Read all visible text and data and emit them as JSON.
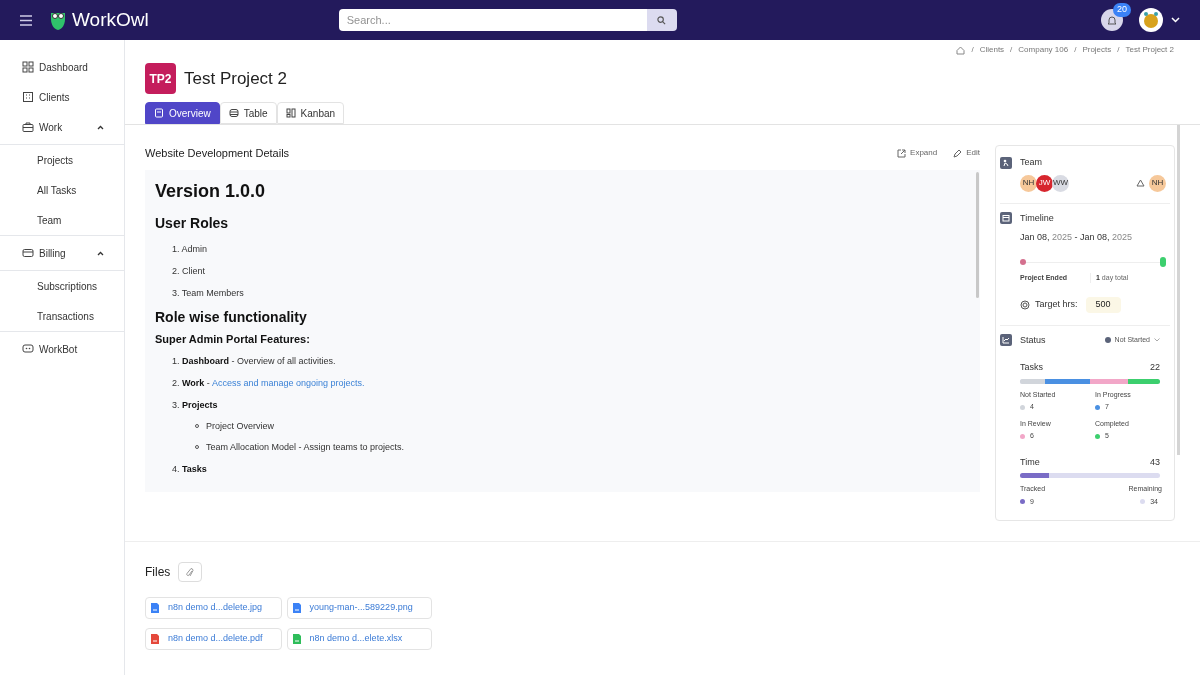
{
  "app": {
    "name": "WorkOwl"
  },
  "search": {
    "placeholder": "Search..."
  },
  "notifications": {
    "count": "20"
  },
  "sidebar": {
    "items": [
      {
        "label": "Dashboard",
        "kind": "grid"
      },
      {
        "label": "Clients",
        "kind": "building"
      },
      {
        "label": "Work",
        "kind": "briefcase",
        "expanded": true,
        "children": [
          {
            "label": "Projects"
          },
          {
            "label": "All Tasks"
          },
          {
            "label": "Team"
          }
        ]
      },
      {
        "label": "Billing",
        "kind": "card",
        "expanded": true,
        "children": [
          {
            "label": "Subscriptions"
          },
          {
            "label": "Transactions"
          }
        ]
      },
      {
        "label": "WorkBot",
        "kind": "bot"
      }
    ]
  },
  "breadcrumb": {
    "separator": "/",
    "items": [
      "Clients",
      "Company 106",
      "Projects",
      "Test Project 2"
    ]
  },
  "project": {
    "badge": "TP2",
    "title": "Test Project 2"
  },
  "tabs": [
    {
      "label": "Overview",
      "kind": "doc",
      "selected": true
    },
    {
      "label": "Table",
      "kind": "table",
      "selected": false
    },
    {
      "label": "Kanban",
      "kind": "kanban",
      "selected": false
    }
  ],
  "details": {
    "title": "Website Development Details",
    "actions": [
      {
        "label": "Expand",
        "kind": "expand"
      },
      {
        "label": "Edit",
        "kind": "pencil"
      }
    ],
    "blocks": [
      {
        "kind": "h1",
        "text": "Version 1.0.0"
      },
      {
        "kind": "h2",
        "text": "User Roles"
      },
      {
        "kind": "ol",
        "items": [
          {
            "number": "1.",
            "text": "Admin"
          },
          {
            "number": "2.",
            "text": "Client"
          },
          {
            "number": "3.",
            "text": "Team Members"
          }
        ]
      },
      {
        "kind": "h2",
        "text": "Role wise functionality"
      },
      {
        "kind": "h3",
        "text": "Super Admin Portal Features:"
      },
      {
        "kind": "ol",
        "items": [
          {
            "number": "1.",
            "lead": "Dashboard",
            "dash": "-",
            "text": "Overview of all activities."
          },
          {
            "number": "2.",
            "lead": "Work",
            "dash": "-",
            "text": "Access and manage ongoing projects.",
            "link": true
          },
          {
            "number": "3.",
            "lead": "Projects",
            "children": [
              "Project Overview",
              "Team Allocation Model - Assign teams to projects."
            ]
          },
          {
            "number": "4.",
            "lead": "Tasks"
          }
        ]
      }
    ]
  },
  "team": {
    "title": "Team",
    "members": [
      {
        "initials": "NH",
        "color": "#f6c89a"
      },
      {
        "initials": "JW",
        "color": "#d7262e"
      },
      {
        "initials": "WW",
        "color": "#d9dbe3"
      }
    ],
    "owner": {
      "initials": "NH",
      "color": "#f6c89a"
    }
  },
  "timeline": {
    "title": "Timeline",
    "start_date": "Jan 08,",
    "start_year": "2025",
    "separator": "-",
    "end_date": "Jan 08,",
    "end_year": "2025",
    "state": "Project Ended",
    "duration_value": "1",
    "duration_unit": "day total",
    "target_label": "Target hrs:",
    "target_value": "500"
  },
  "status": {
    "title": "Status",
    "value": "Not Started",
    "color": "#5b6379"
  },
  "tasks": {
    "label": "Tasks",
    "total": "22",
    "segments": [
      {
        "label": "Not Started",
        "count": "4",
        "color": "#d1d5db"
      },
      {
        "label": "In Progress",
        "count": "7",
        "color": "#4a90e2"
      },
      {
        "label": "In Review",
        "count": "6",
        "color": "#f2a7c8"
      },
      {
        "label": "Completed",
        "count": "5",
        "color": "#3ccf6e"
      }
    ]
  },
  "time": {
    "label": "Time",
    "total": "43",
    "level": 0.21,
    "tracked": {
      "label": "Tracked",
      "count": "9",
      "color": "#7a6cc6"
    },
    "remaining": {
      "label": "Remaining",
      "count": "34",
      "color": "#dcdcf0"
    }
  },
  "files": {
    "title": "Files",
    "items": [
      {
        "name": "n8n demo d...delete.jpg",
        "kind": "image"
      },
      {
        "name": "young-man-...589229.png",
        "kind": "image"
      },
      {
        "name": "n8n demo d...delete.pdf",
        "kind": "pdf"
      },
      {
        "name": "n8n demo d...elete.xlsx",
        "kind": "sheet"
      }
    ]
  }
}
